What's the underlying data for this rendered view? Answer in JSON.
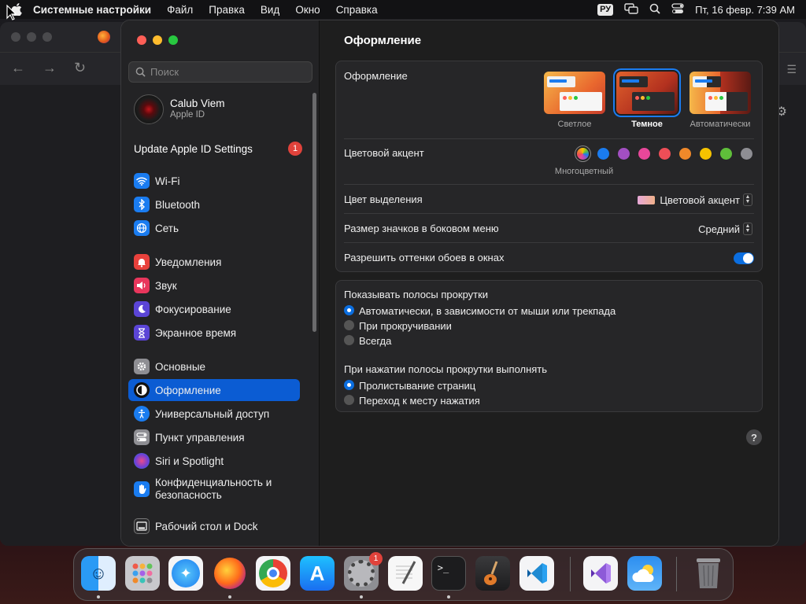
{
  "menubar": {
    "app_name": "Системные настройки",
    "items": [
      "Файл",
      "Правка",
      "Вид",
      "Окно",
      "Справка"
    ],
    "input_source": "РУ",
    "clock": "Пт, 16 февр.  7:39 AM"
  },
  "sidebar": {
    "search_placeholder": "Поиск",
    "account": {
      "name": "Calub Viem",
      "subtitle": "Apple ID"
    },
    "update": {
      "label": "Update Apple ID Settings",
      "badge": "1"
    },
    "items": [
      {
        "label": "Wi-Fi",
        "icon": "wifi-icon",
        "color": "#1a7cf0"
      },
      {
        "label": "Bluetooth",
        "icon": "bluetooth-icon",
        "color": "#1a7cf0"
      },
      {
        "label": "Сеть",
        "icon": "globe-icon",
        "color": "#1a7cf0"
      },
      {
        "label": "Уведомления",
        "icon": "bell-icon",
        "color": "#e8413c"
      },
      {
        "label": "Звук",
        "icon": "speaker-icon",
        "color": "#e8365c"
      },
      {
        "label": "Фокусирование",
        "icon": "moon-icon",
        "color": "#5b45d6"
      },
      {
        "label": "Экранное время",
        "icon": "hourglass-icon",
        "color": "#5b45d6"
      },
      {
        "label": "Основные",
        "icon": "gear-icon",
        "color": "#8e8e93"
      },
      {
        "label": "Оформление",
        "icon": "appearance-icon",
        "color": "#111111"
      },
      {
        "label": "Универсальный доступ",
        "icon": "accessibility-icon",
        "color": "#1a7cf0"
      },
      {
        "label": "Пункт управления",
        "icon": "control-center-icon",
        "color": "#8e8e93"
      },
      {
        "label": "Siri и Spotlight",
        "icon": "siri-icon",
        "color": "#7a3fd0"
      },
      {
        "label": "Конфиденциальность и безопасность",
        "icon": "hand-icon",
        "color": "#1a7cf0"
      },
      {
        "label": "Рабочий стол и Dock",
        "icon": "dock-icon",
        "color": "#2b2b2d"
      }
    ]
  },
  "main": {
    "title": "Оформление",
    "appearance": {
      "label": "Оформление",
      "options": [
        "Светлое",
        "Темное",
        "Автоматически"
      ],
      "selected": "Темное"
    },
    "accent": {
      "label": "Цветовой акцент",
      "selected_name": "Многоцветный",
      "colors": [
        "#1a7cf0",
        "#a24fc2",
        "#e8479a",
        "#ee4e57",
        "#f0892a",
        "#f5c300",
        "#5fbf3a",
        "#8e8e93"
      ]
    },
    "highlight": {
      "label": "Цвет выделения",
      "value": "Цветовой акцент"
    },
    "sidebar_icon_size": {
      "label": "Размер значков в боковом меню",
      "value": "Средний"
    },
    "wallpaper_tinting": {
      "label": "Разрешить оттенки обоев в окнах",
      "enabled": true
    },
    "scrollbars": {
      "label": "Показывать полосы прокрутки",
      "options": [
        "Автоматически, в зависимости от мыши или трекпада",
        "При прокручивании",
        "Всегда"
      ],
      "selected": 0
    },
    "click_scrollbar": {
      "label": "При нажатии полосы прокрутки выполнять",
      "options": [
        "Пролистывание страниц",
        "Переход к месту нажатия"
      ],
      "selected": 0
    },
    "help": "?"
  },
  "dock": {
    "apps": [
      "Finder",
      "Launchpad",
      "Safari",
      "Firefox",
      "Chrome",
      "App Store",
      "Системные настройки",
      "TextEdit",
      "Terminal",
      "GarageBand",
      "VS Code",
      "Visual Studio",
      "Weather",
      "Корзина"
    ],
    "settings_badge": "1"
  }
}
